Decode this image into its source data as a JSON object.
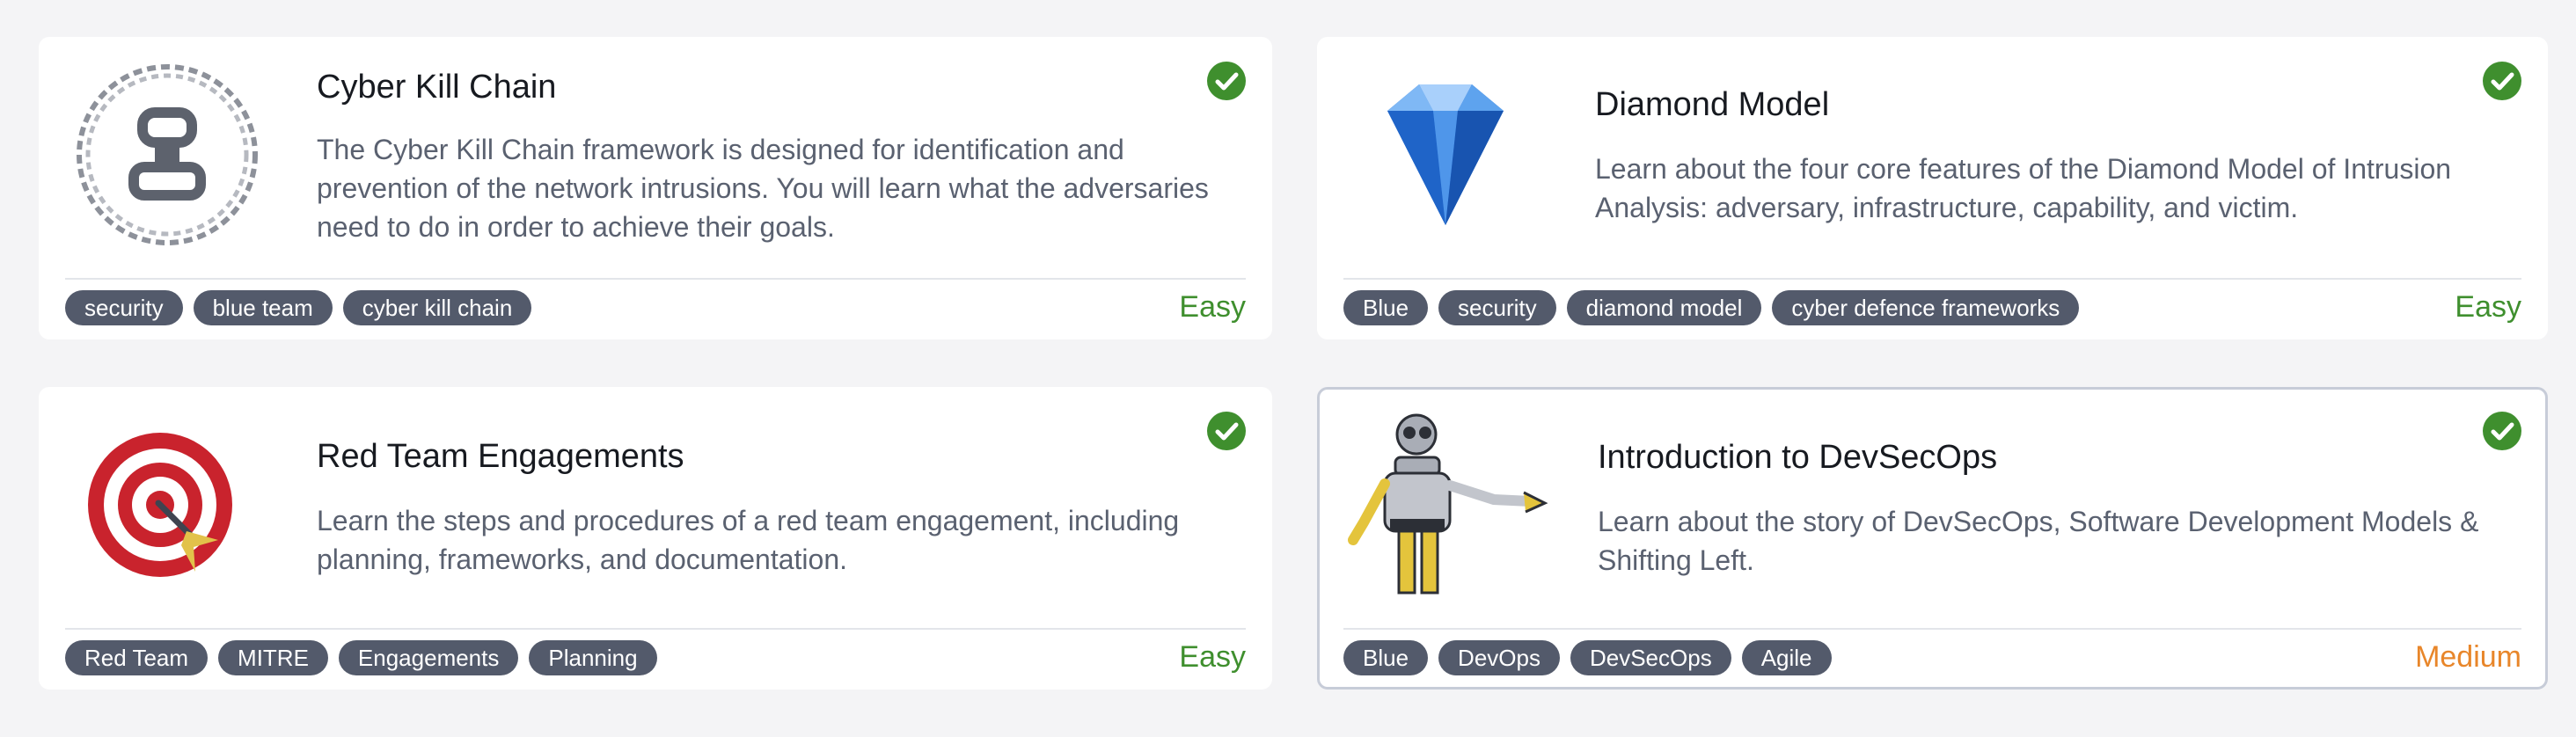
{
  "colors": {
    "easy": "#3f8f2e",
    "medium": "#e8862a",
    "completed_check": "#3f8f2e",
    "tag_bg": "#535a6b"
  },
  "cards": [
    {
      "title": "Cyber Kill Chain",
      "description": "The Cyber Kill Chain framework is designed for identification and prevention of the network intrusions. You will learn what the adversaries need to do in order to achieve their goals.",
      "tags": [
        "security",
        "blue team",
        "cyber kill chain"
      ],
      "difficulty": "Easy",
      "completed": true,
      "icon": "chain-circle-icon"
    },
    {
      "title": "Diamond Model",
      "description": "Learn about the four core features of the Diamond Model of Intrusion Analysis: adversary, infrastructure, capability, and victim.",
      "tags": [
        "Blue",
        "security",
        "diamond model",
        "cyber defence frameworks"
      ],
      "difficulty": "Easy",
      "completed": true,
      "icon": "diamond-icon"
    },
    {
      "title": "Red Team Engagements",
      "description": "Learn the steps and procedures of a red team engagement, including planning, frameworks, and documentation.",
      "tags": [
        "Red Team",
        "MITRE",
        "Engagements",
        "Planning"
      ],
      "difficulty": "Easy",
      "completed": true,
      "icon": "target-dart-icon"
    },
    {
      "title": "Introduction to DevSecOps",
      "description": "Learn about the story of DevSecOps, Software Development Models & Shifting Left.",
      "tags": [
        "Blue",
        "DevOps",
        "DevSecOps",
        "Agile"
      ],
      "difficulty": "Medium",
      "completed": true,
      "icon": "robot-icon"
    }
  ]
}
